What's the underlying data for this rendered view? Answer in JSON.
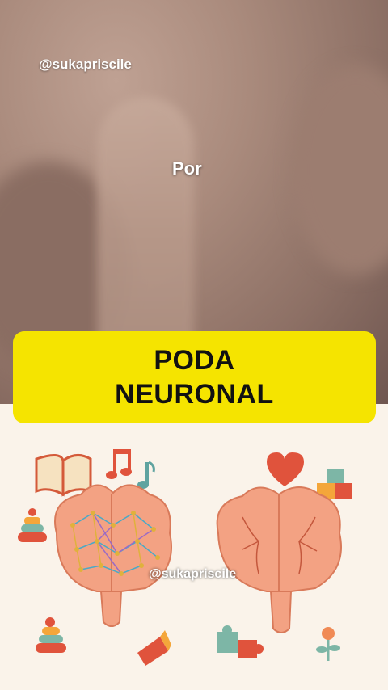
{
  "video": {
    "watermark_top": "@sukapriscile",
    "caption": "Por"
  },
  "title": {
    "line1": "PODA",
    "line2": "NEURONAL",
    "bg_color": "#f5e400"
  },
  "illustration": {
    "watermark": "@sukapriscile",
    "icons": [
      "book-icon",
      "music-notes-icon",
      "stacking-rings-icon",
      "brain-with-connections-icon",
      "brain-pruned-icon",
      "heart-icon",
      "alphabet-blocks-icon",
      "puzzle-icon",
      "flower-icon",
      "toy-block-icon"
    ]
  }
}
